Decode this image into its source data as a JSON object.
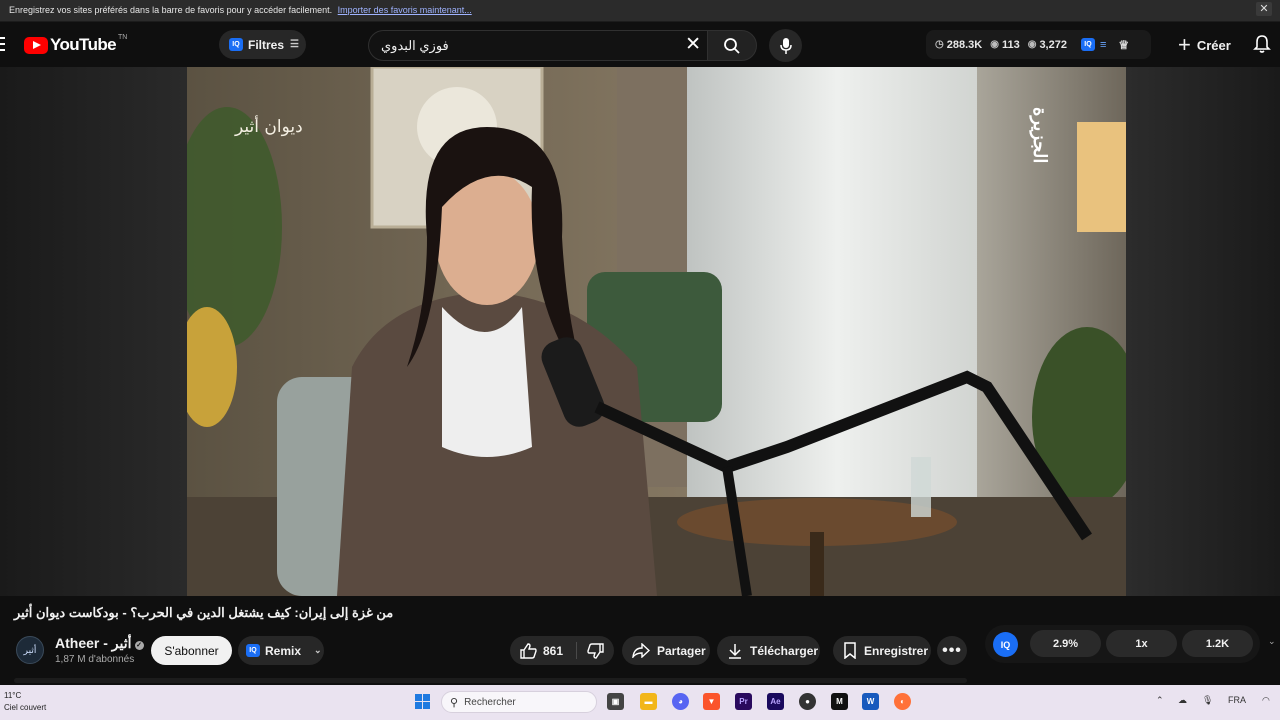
{
  "bookmark_bar": {
    "message": "Enregistrez vos sites préférés dans la barre de favoris pour y accéder facilement.",
    "import_link": "Importer des favoris maintenant..."
  },
  "masthead": {
    "logo_text": "YouTube",
    "country_code": "TN",
    "filters_label": "Filtres",
    "iq_label": "IQ",
    "search_value": "فوزي البدوي",
    "stats": [
      {
        "icon": "clock-icon",
        "value": "288.3K"
      },
      {
        "icon": "eye-icon",
        "value": "113"
      },
      {
        "icon": "eye-icon",
        "value": "3,272"
      }
    ],
    "create_label": "Créer"
  },
  "video": {
    "title": "من غزة إلى إيران: كيف يشتغل الدين في الحرب؟ - بودكاست ديوان أثير",
    "watermark_left": "ديوان أثير",
    "watermark_right": "الجزيرة"
  },
  "channel": {
    "name": "Atheer - أثير",
    "avatar_text": "أثير",
    "subscribers": "1,87 M d'abonnés",
    "subscribe_label": "S'abonner",
    "remix_label": "Remix"
  },
  "actions": {
    "like_count": "861",
    "share_label": "Partager",
    "download_label": "Télécharger",
    "save_label": "Enregistrer",
    "more_label": "•••"
  },
  "iq_panel": {
    "label": "IQ",
    "values": [
      "2.9%",
      "1x",
      "1.2K"
    ]
  },
  "taskbar": {
    "temperature": "11°C",
    "weather": "Ciel couvert",
    "search_placeholder": "Rechercher",
    "language": "FRA",
    "apps": [
      {
        "icon": "file-explorer-icon",
        "color": "#f2b619"
      },
      {
        "icon": "discord-icon",
        "color": "#5865f2"
      },
      {
        "icon": "brave-icon",
        "color": "#fb542b"
      },
      {
        "icon": "premiere-icon",
        "color": "#2a0a5e",
        "text": "Pr"
      },
      {
        "icon": "after-effects-icon",
        "color": "#1a0a5e",
        "text": "Ae"
      },
      {
        "icon": "obs-icon",
        "color": "#333333"
      },
      {
        "icon": "capcut-icon",
        "color": "#111111",
        "text": "M"
      },
      {
        "icon": "word-icon",
        "color": "#185abd"
      },
      {
        "icon": "firefox-icon",
        "color": "#ff7139"
      }
    ]
  },
  "colors": {
    "youtube_red": "#ff0000",
    "iq_blue": "#1a6ef5",
    "background": "#0f0f0f",
    "pill": "#272727"
  }
}
